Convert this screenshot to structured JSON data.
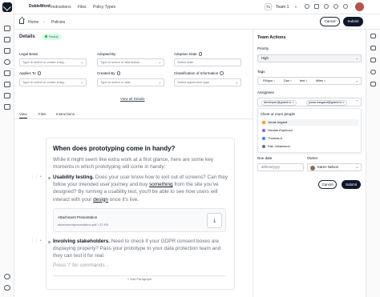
{
  "topbar": {
    "brand": "DobleWord",
    "nav": [
      "Instructions",
      "Files",
      "Policy Types"
    ],
    "team_badge": "T1",
    "team_label": "Team 1"
  },
  "breadcrumb": {
    "home": "Home",
    "current": "Policies"
  },
  "header_actions": {
    "cancel": "Cancel",
    "submit": "Submit"
  },
  "details": {
    "title": "Details",
    "status": "Ready",
    "fields": {
      "legal_basis": {
        "label": "Legal Basis",
        "placeholder": "Type to select or create a tag..."
      },
      "adopted_by": {
        "label": "Adopted By",
        "placeholder": "Type to select or add status"
      },
      "adoption_date": {
        "label": "Adoption Date",
        "placeholder": "Select date"
      },
      "applies_to": {
        "label": "Applies To",
        "placeholder": "Type to select or create a tag..."
      },
      "created_by": {
        "label": "Created By",
        "placeholder": "Type to select or add..."
      },
      "classification": {
        "label": "Classification of Information",
        "placeholder": "Select agreement type"
      }
    },
    "view_all": "View all Details"
  },
  "tabs": [
    "View",
    "Files",
    "Instructions"
  ],
  "editor": {
    "title": "When does prototyping come in handy?",
    "intro": "While it might seem like extra work at a first glance, here are some key moments in which prototyping will come in handy:",
    "item1_bold": "Usability testing.",
    "item1_a": " Does your user know how to exit out of screens? Can they follow your intended user journey and buy ",
    "item1_u1": "something",
    "item1_b": " from the site you've designed? By running a usability test, you'll be able to see how users will interact with your ",
    "item1_u2": "design",
    "item1_c": " once it's live.",
    "attachment": {
      "name": "Attachment Presentation",
      "meta": "attachmentpresentation.pdf • 22 KB"
    },
    "item2_bold": "Involving stakeholders.",
    "item2_text": " Need to check if your GDPR consent boxes are displaying properly? Pass your prototype to your data protection team and they can test it for real.",
    "command_placeholder": "Press '/' for commands...",
    "add_paragraph": "+ Add Paragraph"
  },
  "team_actions": {
    "title": "Team Actions",
    "priority_label": "Priority",
    "priority_value": "High",
    "tags_label": "Tags",
    "tags": [
      "Fillippo",
      "Dan",
      "test",
      "Miles"
    ],
    "assignees_label": "Assignees",
    "assignees": [
      "developer@grand.io",
      "jonas.hasgard@grand.io"
    ],
    "dropdown": {
      "heading": "Client or more people",
      "people": [
        "Jonas hogard",
        "Nicolas Espinoza",
        "Thomas A",
        "Dan Johansson"
      ]
    },
    "due_date_label": "Due date",
    "due_date_placeholder": "dd/mm/yyyy",
    "owner_label": "Owner",
    "owner_value": "Karen Nelson",
    "cancel": "Cancel",
    "submit": "Submit"
  },
  "colors": {
    "accent_dark": "#0f172a",
    "ready_green": "#16a34a",
    "avatar_brown": "#b45348"
  },
  "icons": {
    "rail": [
      "logo",
      "home-icon",
      "inbox-icon",
      "calendar-icon",
      "people-icon",
      "chart-icon",
      "folder-icon",
      "document-icon",
      "bookmark-icon",
      "settings-icon",
      "help-icon"
    ],
    "right_rail": [
      "chat-icon",
      "comment-icon",
      "tag-icon",
      "search-icon",
      "link-icon"
    ]
  }
}
